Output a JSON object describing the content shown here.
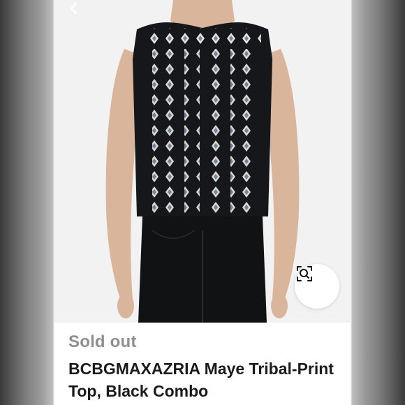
{
  "listing": {
    "status": "Sold out",
    "title": "BCBGMAXAZRIA Maye Tribal-Print Top, Black Combo"
  },
  "icons": {
    "back": "chevron-left-icon",
    "zoom": "zoom-search-icon"
  },
  "colors": {
    "top_base": "#15171b",
    "pattern_light": "#f2ede4",
    "pattern_blue": "#6e8fb0",
    "pants": "#111214",
    "skin": "#d9b59c"
  }
}
